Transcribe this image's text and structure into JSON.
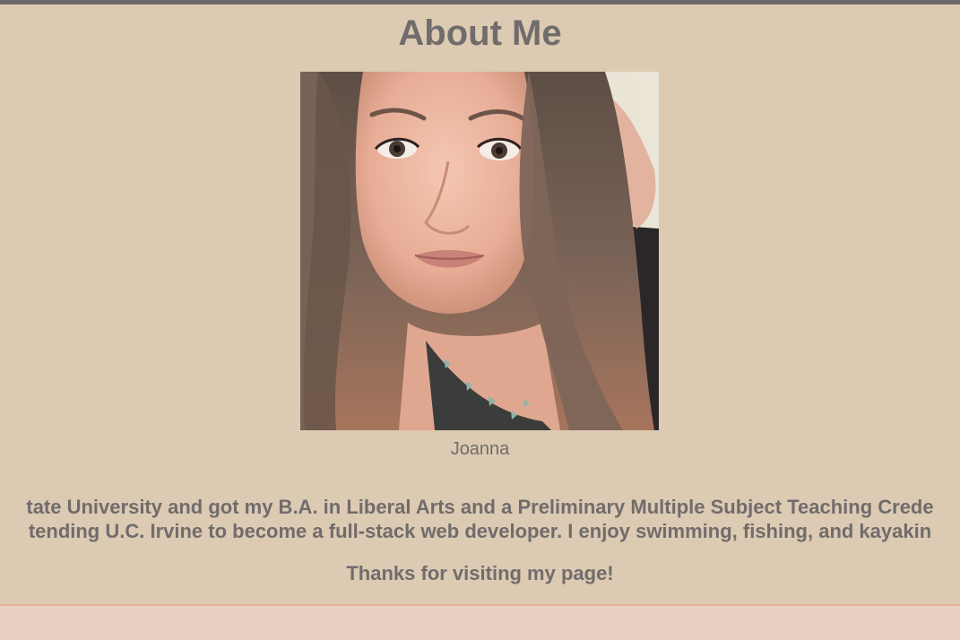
{
  "page": {
    "title": "About Me"
  },
  "profile": {
    "photo_alt": "Portrait photo of Joanna",
    "caption": "Joanna"
  },
  "bio": {
    "line1": "tate University and got my B.A. in Liberal Arts and a Preliminary Multiple Subject Teaching Crede",
    "line2": "tending U.C. Irvine to become a full-stack web developer. I enjoy swimming, fishing, and kayakin",
    "thanks": "Thanks for visiting my page!"
  },
  "colors": {
    "background": "#dccab2",
    "text": "#716c6c",
    "top_bar": "#6b6766",
    "footer": "#ead0c3"
  }
}
